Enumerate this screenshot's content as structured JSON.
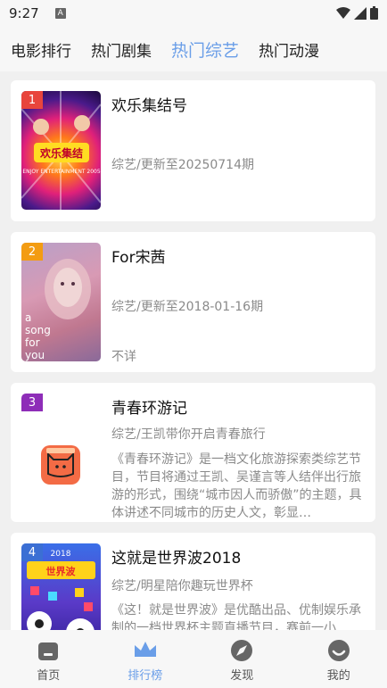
{
  "status": {
    "time": "9:27",
    "badge": "A"
  },
  "tabs": [
    {
      "label": "电影排行"
    },
    {
      "label": "热门剧集"
    },
    {
      "label": "热门综艺",
      "active": true
    },
    {
      "label": "热门动漫"
    }
  ],
  "items": [
    {
      "rank": "1",
      "rank_color": "#e8453c",
      "title": "欢乐集结号",
      "subtitle": "综艺/更新至20250714期",
      "desc": "",
      "poster_text": "ENJOY ENTERTAINMENT 2005"
    },
    {
      "rank": "2",
      "rank_color": "#f39c12",
      "title": "For宋茜",
      "subtitle": "综艺/更新至2018-01-16期",
      "desc": "不详",
      "poster_text": "a song for you"
    },
    {
      "rank": "3",
      "rank_color": "#8e2db8",
      "title": "青春环游记",
      "subtitle": "综艺/王凯带你开启青春旅行",
      "desc": "《青春环游记》是一档文化旅游探索类综艺节目，节目将通过王凯、吴谨言等人结伴出行旅游的形式，围绕“城市因人而骄傲”的主题，具体讲述不同城市的历史人文，彰显…",
      "poster_text": ""
    },
    {
      "rank": "4",
      "rank_color": "#3b6fd4",
      "title": "这就是世界波2018",
      "subtitle": "综艺/明星陪你趣玩世界杯",
      "desc": "《这！就是世界波》是优酷出品、优制娱乐承制的一档世界杯主题直播节目，赛前一小",
      "poster_text": "2018"
    }
  ],
  "nav": [
    {
      "label": "首页",
      "icon": "home-icon"
    },
    {
      "label": "排行榜",
      "icon": "crown-icon",
      "active": true
    },
    {
      "label": "发现",
      "icon": "compass-icon"
    },
    {
      "label": "我的",
      "icon": "smile-icon"
    }
  ],
  "colors": {
    "accent": "#6a9ee8"
  }
}
